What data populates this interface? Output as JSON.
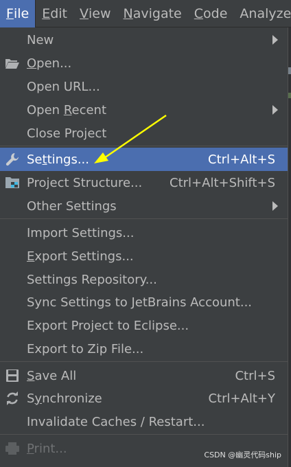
{
  "menubar": {
    "items": [
      {
        "label": "File",
        "mnemonic": "F",
        "rest": "ile",
        "active": true
      },
      {
        "label": "Edit",
        "mnemonic": "E",
        "rest": "dit"
      },
      {
        "label": "View",
        "mnemonic": "V",
        "rest": "iew"
      },
      {
        "label": "Navigate",
        "mnemonic": "N",
        "rest": "avigate"
      },
      {
        "label": "Code",
        "mnemonic": "C",
        "rest": "ode"
      },
      {
        "label": "Analyze",
        "mnemonic": "",
        "rest": "Analyze"
      }
    ]
  },
  "file_menu": {
    "new": {
      "label": "New",
      "icon": "none"
    },
    "open": {
      "label": "Open...",
      "pre": "",
      "mnem": "O",
      "post": "pen...",
      "icon": "folder-open-icon"
    },
    "open_url": {
      "label": "Open URL..."
    },
    "open_recent": {
      "label": "Open Recent",
      "pre": "Open ",
      "mnem": "R",
      "post": "ecent"
    },
    "close_project": {
      "label": "Close Project"
    },
    "settings": {
      "label": "Settings...",
      "pre": "Se",
      "mnem": "t",
      "post": "tings...",
      "shortcut": "Ctrl+Alt+S",
      "icon": "wrench-icon"
    },
    "project_structure": {
      "label": "Project Structure...",
      "shortcut": "Ctrl+Alt+Shift+S",
      "icon": "project-structure-icon"
    },
    "other_settings": {
      "label": "Other Settings"
    },
    "import_settings": {
      "label": "Import Settings..."
    },
    "export_settings": {
      "label": "Export Settings...",
      "pre": "",
      "mnem": "E",
      "post": "xport Settings..."
    },
    "settings_repository": {
      "label": "Settings Repository..."
    },
    "sync_settings": {
      "label": "Sync Settings to JetBrains Account..."
    },
    "export_eclipse": {
      "label": "Export Project to Eclipse..."
    },
    "export_zip": {
      "label": "Export to Zip File..."
    },
    "save_all": {
      "label": "Save All",
      "pre": "",
      "mnem": "S",
      "post": "ave All",
      "shortcut": "Ctrl+S",
      "icon": "save-icon"
    },
    "synchronize": {
      "label": "Synchronize",
      "pre": "S",
      "mnem": "y",
      "post": "nchronize",
      "shortcut": "Ctrl+Alt+Y",
      "icon": "sync-icon"
    },
    "invalidate": {
      "label": "Invalidate Caches / Restart..."
    },
    "print": {
      "label": "Print...",
      "pre": "",
      "mnem": "P",
      "post": "rint...",
      "icon": "print-icon",
      "disabled": true
    }
  },
  "selected_item": "settings",
  "watermark": "CSDN @幽灵代码ship",
  "colors": {
    "menu_bg": "#3c3f41",
    "selection": "#4b6eaf",
    "text": "#bbbbbb",
    "separator": "#515151",
    "annotation_arrow": "#ffff00"
  }
}
